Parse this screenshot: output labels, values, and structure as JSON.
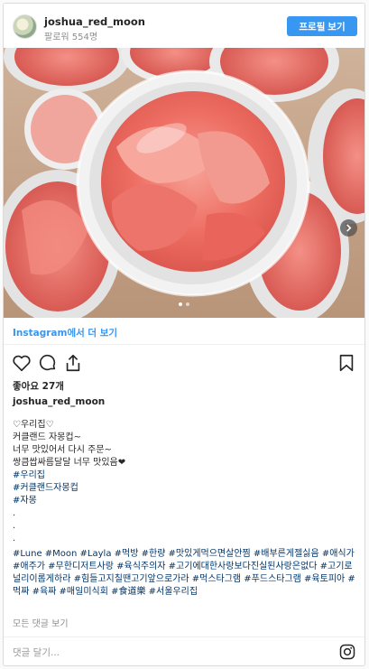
{
  "header": {
    "username": "joshua_red_moon",
    "followers": "팔로워 554명",
    "profile_button": "프로필 보기"
  },
  "photo": {
    "subject": "",
    "slide_count": 2,
    "active_slide": 1
  },
  "more_link": "Instagram에서 더 보기",
  "actions": {
    "icons": [
      "heart-icon",
      "comment-icon",
      "share-icon",
      "bookmark-icon"
    ]
  },
  "likes": "좋아요 27개",
  "poster": "joshua_red_moon",
  "caption_lines": [
    "♡우리집♡",
    "커클랜드 자몽컵~",
    "너무 맛있어서 다시 주문~",
    "쌍큼쌉싸름달달 너무 맛있음❤",
    "#우리집",
    "#커클랜드자몽컵",
    "#자몽",
    ".",
    ".",
    "."
  ],
  "hashtags": "#Lune #Moon #Layla #먹방 #한량 #맛있게먹으면살안찜 #배부른게젤싫음 #애식가 #애주가 #무한디저트사랑 #육식주의자 #고기에대한사랑보다진실된사랑은없다 #고기로널리이롭게하라 #힘들고지칠땐고기앞으로가라 #먹스타그램 #푸드스타그램 #육토피아 #먹짜 #육짜 #매일미식회 #食道樂 #서울우리집",
  "all_comments": "모든 댓글 보기",
  "comment": {
    "placeholder": "댓글 달기..."
  },
  "colors": {
    "accent": "#3897f0",
    "hashtag": "#003569",
    "muted": "#8e8e8e"
  }
}
